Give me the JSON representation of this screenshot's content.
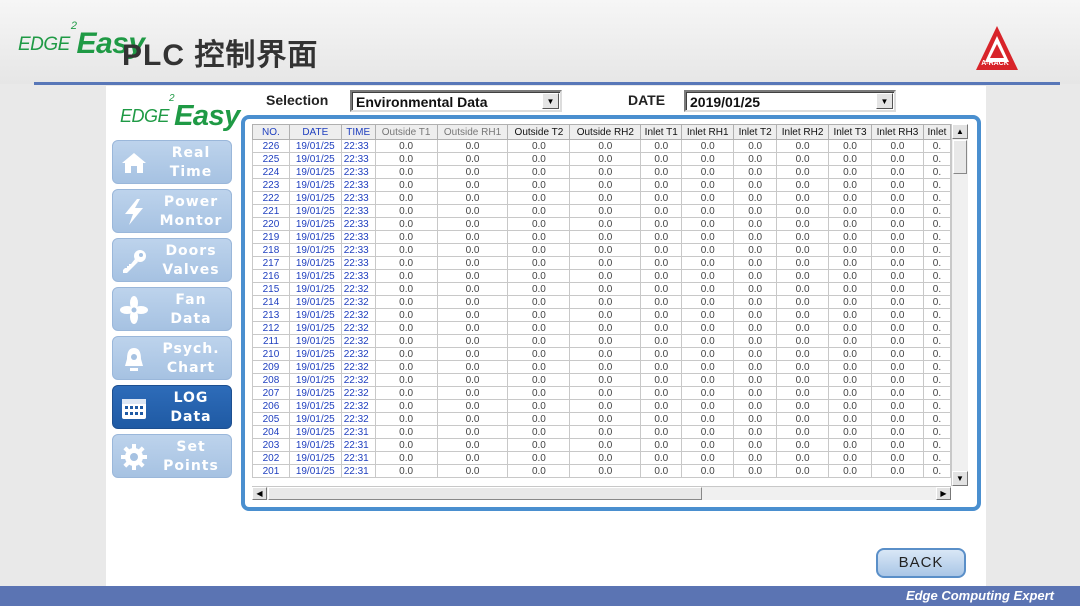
{
  "header": {
    "logo": {
      "prefix": "EDGE",
      "sup": "2",
      "main": "Easy"
    },
    "title": "PLC 控制界面",
    "brand_badge": "A-RACK"
  },
  "sidebar": {
    "logo": {
      "prefix": "EDGE",
      "sup": "2",
      "main": "Easy"
    },
    "items": [
      {
        "line1": "Real",
        "line2": "Time",
        "icon": "home-icon",
        "active": false
      },
      {
        "line1": "Power",
        "line2": "Montor",
        "icon": "lightning-icon",
        "active": false
      },
      {
        "line1": "Doors",
        "line2": "Valves",
        "icon": "key-icon",
        "active": false
      },
      {
        "line1": "Fan",
        "line2": "Data",
        "icon": "fan-icon",
        "active": false
      },
      {
        "line1": "Psych.",
        "line2": "Chart",
        "icon": "bell-icon",
        "active": false
      },
      {
        "line1": "LOG",
        "line2": "Data",
        "icon": "calendar-icon",
        "active": true
      },
      {
        "line1": "Set",
        "line2": "Points",
        "icon": "gear-icon",
        "active": false
      }
    ]
  },
  "filters": {
    "selection_label": "Selection",
    "selection_value": "Environmental Data",
    "date_label": "DATE",
    "date_value": "2019/01/25"
  },
  "table": {
    "columns": [
      "NO.",
      "DATE",
      "TIME",
      "Outside T1",
      "Outside RH1",
      "Outside T2",
      "Outside RH2",
      "Inlet T1",
      "Inlet RH1",
      "Inlet T2",
      "Inlet RH2",
      "Inlet T3",
      "Inlet RH3",
      "Inlet"
    ],
    "rows": [
      {
        "no": "226",
        "date": "19/01/25",
        "time": "22:33"
      },
      {
        "no": "225",
        "date": "19/01/25",
        "time": "22:33"
      },
      {
        "no": "224",
        "date": "19/01/25",
        "time": "22:33"
      },
      {
        "no": "223",
        "date": "19/01/25",
        "time": "22:33"
      },
      {
        "no": "222",
        "date": "19/01/25",
        "time": "22:33"
      },
      {
        "no": "221",
        "date": "19/01/25",
        "time": "22:33"
      },
      {
        "no": "220",
        "date": "19/01/25",
        "time": "22:33"
      },
      {
        "no": "219",
        "date": "19/01/25",
        "time": "22:33"
      },
      {
        "no": "218",
        "date": "19/01/25",
        "time": "22:33"
      },
      {
        "no": "217",
        "date": "19/01/25",
        "time": "22:33"
      },
      {
        "no": "216",
        "date": "19/01/25",
        "time": "22:33"
      },
      {
        "no": "215",
        "date": "19/01/25",
        "time": "22:32"
      },
      {
        "no": "214",
        "date": "19/01/25",
        "time": "22:32"
      },
      {
        "no": "213",
        "date": "19/01/25",
        "time": "22:32"
      },
      {
        "no": "212",
        "date": "19/01/25",
        "time": "22:32"
      },
      {
        "no": "211",
        "date": "19/01/25",
        "time": "22:32"
      },
      {
        "no": "210",
        "date": "19/01/25",
        "time": "22:32"
      },
      {
        "no": "209",
        "date": "19/01/25",
        "time": "22:32"
      },
      {
        "no": "208",
        "date": "19/01/25",
        "time": "22:32"
      },
      {
        "no": "207",
        "date": "19/01/25",
        "time": "22:32"
      },
      {
        "no": "206",
        "date": "19/01/25",
        "time": "22:32"
      },
      {
        "no": "205",
        "date": "19/01/25",
        "time": "22:32"
      },
      {
        "no": "204",
        "date": "19/01/25",
        "time": "22:31"
      },
      {
        "no": "203",
        "date": "19/01/25",
        "time": "22:31"
      },
      {
        "no": "202",
        "date": "19/01/25",
        "time": "22:31"
      },
      {
        "no": "201",
        "date": "19/01/25",
        "time": "22:31"
      }
    ],
    "cell_value": "0.0",
    "truncated_cell": "0."
  },
  "back_button": "BACK",
  "footer": "Edge Computing Expert",
  "colors": {
    "accent": "#4a8fcf",
    "nav": "#a6c2e2",
    "nav_active": "#1f5aa4",
    "logo_green": "#1f9a45",
    "footer": "#5b74b3"
  }
}
